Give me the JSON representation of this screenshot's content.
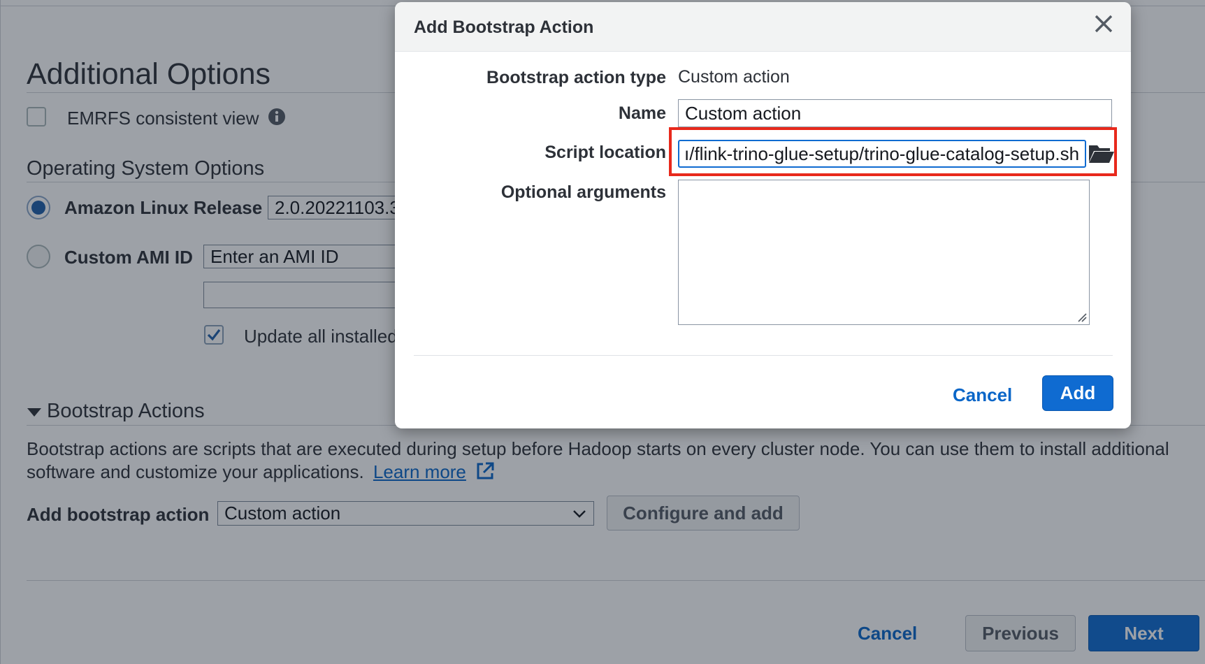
{
  "background": {
    "additional_options": {
      "title": "Additional Options",
      "emrfs_label": "EMRFS consistent view",
      "info_icon": "info-icon"
    },
    "os_options": {
      "title": "Operating System Options",
      "amazon_linux_label": "Amazon Linux Release",
      "amazon_linux_value": "2.0.20221103.3",
      "custom_ami_label": "Custom AMI ID",
      "custom_ami_placeholder": "Enter an AMI ID",
      "update_label": "Update all installed"
    },
    "bootstrap": {
      "title": "Bootstrap Actions",
      "description_line1": "Bootstrap actions are scripts that are executed during setup before Hadoop starts on every cluster node. You can use them to install additional",
      "description_line2": "software and customize your applications.",
      "learn_more": "Learn more",
      "add_label": "Add bootstrap action",
      "select_value": "Custom action",
      "configure_button": "Configure and add"
    },
    "footer": {
      "cancel": "Cancel",
      "previous": "Previous",
      "next": "Next"
    }
  },
  "modal": {
    "title": "Add Bootstrap Action",
    "type_label": "Bootstrap action type",
    "type_value": "Custom action",
    "name_label": "Name",
    "name_value": "Custom action",
    "script_label": "Script location",
    "script_value": "ı/flink-trino-glue-setup/trino-glue-catalog-setup.sh",
    "args_label": "Optional arguments",
    "args_value": "",
    "cancel": "Cancel",
    "add": "Add"
  },
  "colors": {
    "primary_blue": "#0f6bd1",
    "link_blue": "#0a66c8",
    "highlight_red": "#e8291c"
  }
}
